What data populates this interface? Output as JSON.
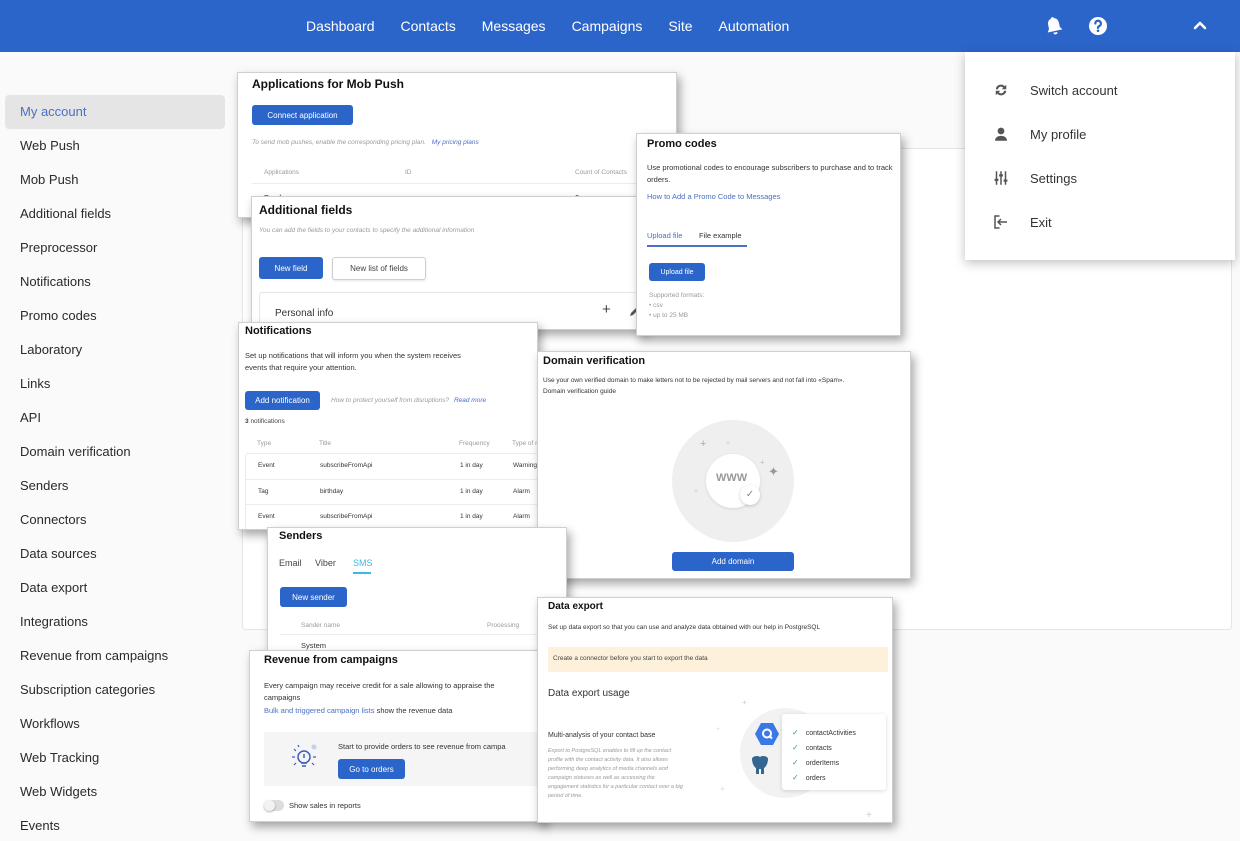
{
  "topbar": {
    "nav": [
      "Dashboard",
      "Contacts",
      "Messages",
      "Campaigns",
      "Site",
      "Automation"
    ],
    "icons": [
      "bell-icon",
      "help-icon",
      "chevron-up-icon"
    ],
    "accent": "#2b65c9"
  },
  "sidebar": {
    "active": "My account",
    "items": [
      "My account",
      "Web Push",
      "Mob Push",
      "Additional fields",
      "Preprocessor",
      "Notifications",
      "Promo codes",
      "Laboratory",
      "Links",
      "API",
      "Domain verification",
      "Senders",
      "Connectors",
      "Data sources",
      "Data export",
      "Integrations",
      "Revenue from campaigns",
      "Subscription categories",
      "Workflows",
      "Web Tracking",
      "Web Widgets",
      "Events"
    ]
  },
  "account_menu": {
    "items": [
      {
        "label": "Switch account",
        "icon": "switch-account-icon"
      },
      {
        "label": "My profile",
        "icon": "user-icon"
      },
      {
        "label": "Settings",
        "icon": "sliders-icon"
      },
      {
        "label": "Exit",
        "icon": "exit-icon"
      }
    ]
  },
  "mob_push": {
    "title": "Applications for Mob Push",
    "button": "Connect application",
    "note": "To send mob pushes, enable the corresponding pricing plan.",
    "note_link": "My pricing plans",
    "columns": [
      "Applications",
      "ID",
      "Count of Contacts"
    ],
    "row": [
      "Purchases",
      "",
      "0"
    ]
  },
  "additional_fields": {
    "title": "Additional fields",
    "subtitle": "You can add the fields to your contacts to specify the additional information",
    "new_field": "New field",
    "new_list": "New list of fields",
    "group": "Personal info",
    "add_icon": "+"
  },
  "promo_codes": {
    "title": "Promo codes",
    "description": "Use promotional codes to encourage subscribers to purchase and to track orders.",
    "link": "How to Add a Promo Code to Messages",
    "tabs": [
      "Upload file",
      "File example"
    ],
    "active_tab": "Upload file",
    "button": "Upload file",
    "formats_title": "Supported formats:",
    "formats": [
      "• csv",
      "• up to 25 MB"
    ]
  },
  "notifications": {
    "title": "Notifications",
    "description_1": "Set up notifications that will inform you when the system receives",
    "description_2": "events that require your attention.",
    "button": "Add notification",
    "hint": "How to protect yourself from disruptions?",
    "hint_link": "Read more",
    "count_num": "3",
    "count_label": "notifications",
    "columns": [
      "Type",
      "Title",
      "Frequency",
      "Type of n"
    ],
    "rows": [
      [
        "Event",
        "subscribeFromApi",
        "1 in day",
        "Warning"
      ],
      [
        "Tag",
        "birthday",
        "1 in day",
        "Alarm"
      ],
      [
        "Event",
        "subscribeFromApi",
        "1 in day",
        "Alarm"
      ]
    ]
  },
  "domain_verification": {
    "title": "Domain verification",
    "description": "Use your own verified domain to make letters not to be rejected by mail servers and not fall into «Spam».",
    "guide": "Domain verification guide",
    "illustration_text": "WWW",
    "button": "Add domain"
  },
  "senders": {
    "title": "Senders",
    "tabs": [
      "Email",
      "Viber",
      "SMS"
    ],
    "active_tab": "SMS",
    "button": "New sender",
    "columns": [
      "Sander name",
      "Processing"
    ],
    "row": "System"
  },
  "revenue": {
    "title": "Revenue from campaigns",
    "description": "Every campaign may receive credit for a sale allowing to appraise the",
    "description_2": "campaigns",
    "link": "Bulk and triggered campaign lists",
    "link_suffix": "show the revenue data",
    "callout": "Start to provide orders to see revenue from campa",
    "button": "Go to orders",
    "toggle_label": "Show sales in reports",
    "toggle_on": false
  },
  "data_export": {
    "title": "Data export",
    "description": "Set up data export so that you can use and analyze data obtained with our help in PostgreSQL",
    "warning": "Create a connector before you start to export the data",
    "usage_title": "Data export usage",
    "subtitle": "Multi-analysis of your contact base",
    "body": [
      "Export to PostgreSQL enables to fill up the contact",
      "profile with the contact activity data. It also allows",
      "performing deep analytics of media channels and",
      "campaign statuses as well as accessing the",
      "engagement statistics for a particular contact over a big",
      "period of time."
    ],
    "tables": [
      "contactActivities",
      "contacts",
      "orderItems",
      "orders"
    ]
  }
}
